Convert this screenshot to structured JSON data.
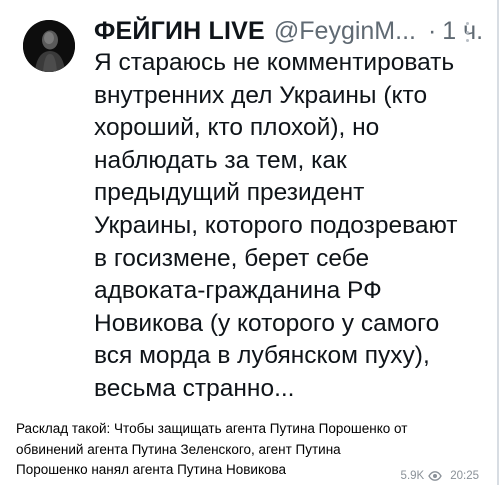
{
  "tweet": {
    "display_name": "ФЕЙГИН LIVE",
    "handle": "@FeyginM...",
    "separator": "·",
    "time": "1 ч.",
    "avatar_icon": "person-silhouette-icon",
    "more_icon": "more-vertical-icon",
    "text": "Я стараюсь не комментировать\nвнутренних дел Украины (кто\nхороший, кто плохой), но\nнаблюдать за тем, как\nпредыдущий президент\nУкраины, которого подозревают\nв госизмене, берет себе\nадвоката-гражданина РФ\nНовикова (у которого у самого\nвся морда в лубянском пуху),\nвесьма странно..."
  },
  "post": {
    "caption": "Расклад такой: Чтобы защищать агента Путина Порошенко от\nобвинений агента Путина Зеленского, агент Путина\nПорошенко нанял агента Путина Новикова",
    "views": "5.9K",
    "views_icon": "eye-icon",
    "time": "20:25"
  },
  "colors": {
    "text_primary": "#0f1419",
    "text_secondary": "#606a73",
    "meta": "#8a9198",
    "avatar_bg": "#0d0d0d"
  }
}
